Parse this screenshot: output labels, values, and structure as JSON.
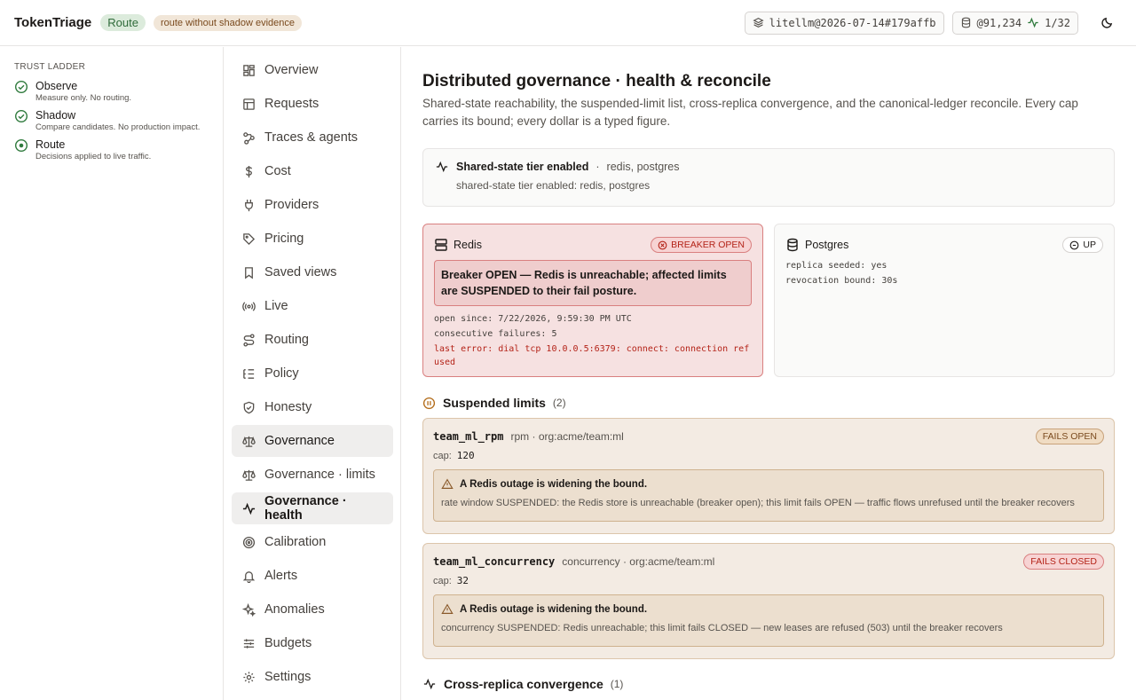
{
  "header": {
    "brand": "TokenTriage",
    "mode_badge": "Route",
    "warn_badge": "route without shadow evidence",
    "version_chip": "litellm@2026-07-14#179affb",
    "ledger_chip": "@91,234",
    "health_chip": "1/32"
  },
  "ladder": {
    "title": "TRUST LADDER",
    "steps": [
      {
        "name": "Observe",
        "desc": "Measure only. No routing."
      },
      {
        "name": "Shadow",
        "desc": "Compare candidates. No production impact."
      },
      {
        "name": "Route",
        "desc": "Decisions applied to live traffic."
      }
    ]
  },
  "nav": {
    "items": [
      {
        "label": "Overview",
        "icon": "grid-icon"
      },
      {
        "label": "Requests",
        "icon": "table-icon"
      },
      {
        "label": "Traces & agents",
        "icon": "trace-icon"
      },
      {
        "label": "Cost",
        "icon": "dollar-icon"
      },
      {
        "label": "Providers",
        "icon": "plug-icon"
      },
      {
        "label": "Pricing",
        "icon": "tag-icon"
      },
      {
        "label": "Saved views",
        "icon": "bookmark-icon"
      },
      {
        "label": "Live",
        "icon": "radio-icon"
      },
      {
        "label": "Routing",
        "icon": "route-icon"
      },
      {
        "label": "Policy",
        "icon": "list-icon"
      },
      {
        "label": "Honesty",
        "icon": "shield-icon"
      },
      {
        "label": "Governance",
        "icon": "scale-icon"
      },
      {
        "label": "Governance · limits",
        "icon": "scale-icon"
      },
      {
        "label": "Governance · health",
        "icon": "activity-icon"
      },
      {
        "label": "Calibration",
        "icon": "target-icon"
      },
      {
        "label": "Alerts",
        "icon": "bell-icon"
      },
      {
        "label": "Anomalies",
        "icon": "sparkle-icon"
      },
      {
        "label": "Budgets",
        "icon": "sliders-icon"
      },
      {
        "label": "Settings",
        "icon": "gear-icon"
      }
    ]
  },
  "main": {
    "title": "Distributed governance · health & reconcile",
    "subtitle": "Shared-state reachability, the suspended-limit list, cross-replica convergence, and the canonical-ledger reconcile. Every cap carries its bound; every dollar is a typed figure.",
    "tier": {
      "title": "Shared-state tier enabled",
      "stores": "redis, postgres",
      "detail": "shared-state tier enabled: redis, postgres"
    },
    "redis": {
      "name": "Redis",
      "status": "BREAKER OPEN",
      "alert": "Breaker OPEN — Redis is unreachable; affected limits are SUSPENDED to their fail posture.",
      "open_since": "open since: 7/22/2026, 9:59:30 PM UTC",
      "failures": "consecutive failures: 5",
      "last_error": "last error: dial tcp 10.0.0.5:6379: connect: connection refused"
    },
    "postgres": {
      "name": "Postgres",
      "status": "UP",
      "replica": "replica seeded: yes",
      "revocation": "revocation bound: 30s"
    },
    "suspended": {
      "title": "Suspended limits",
      "count": "(2)",
      "limits": [
        {
          "name": "team_ml_rpm",
          "meta": "rpm · org:acme/team:ml",
          "posture": "FAILS OPEN",
          "cap_label": "cap:",
          "cap": "120",
          "warn_title": "A Redis outage is widening the bound.",
          "warn_detail": "rate window SUSPENDED: the Redis store is unreachable (breaker open); this limit fails OPEN — traffic flows unrefused until the breaker recovers"
        },
        {
          "name": "team_ml_concurrency",
          "meta": "concurrency · org:acme/team:ml",
          "posture": "FAILS CLOSED",
          "cap_label": "cap:",
          "cap": "32",
          "warn_title": "A Redis outage is widening the bound.",
          "warn_detail": "concurrency SUSPENDED: Redis unreachable; this limit fails CLOSED — new leases are refused (503) until the breaker recovers"
        }
      ]
    },
    "convergence": {
      "title": "Cross-replica convergence",
      "count": "(1)"
    }
  }
}
